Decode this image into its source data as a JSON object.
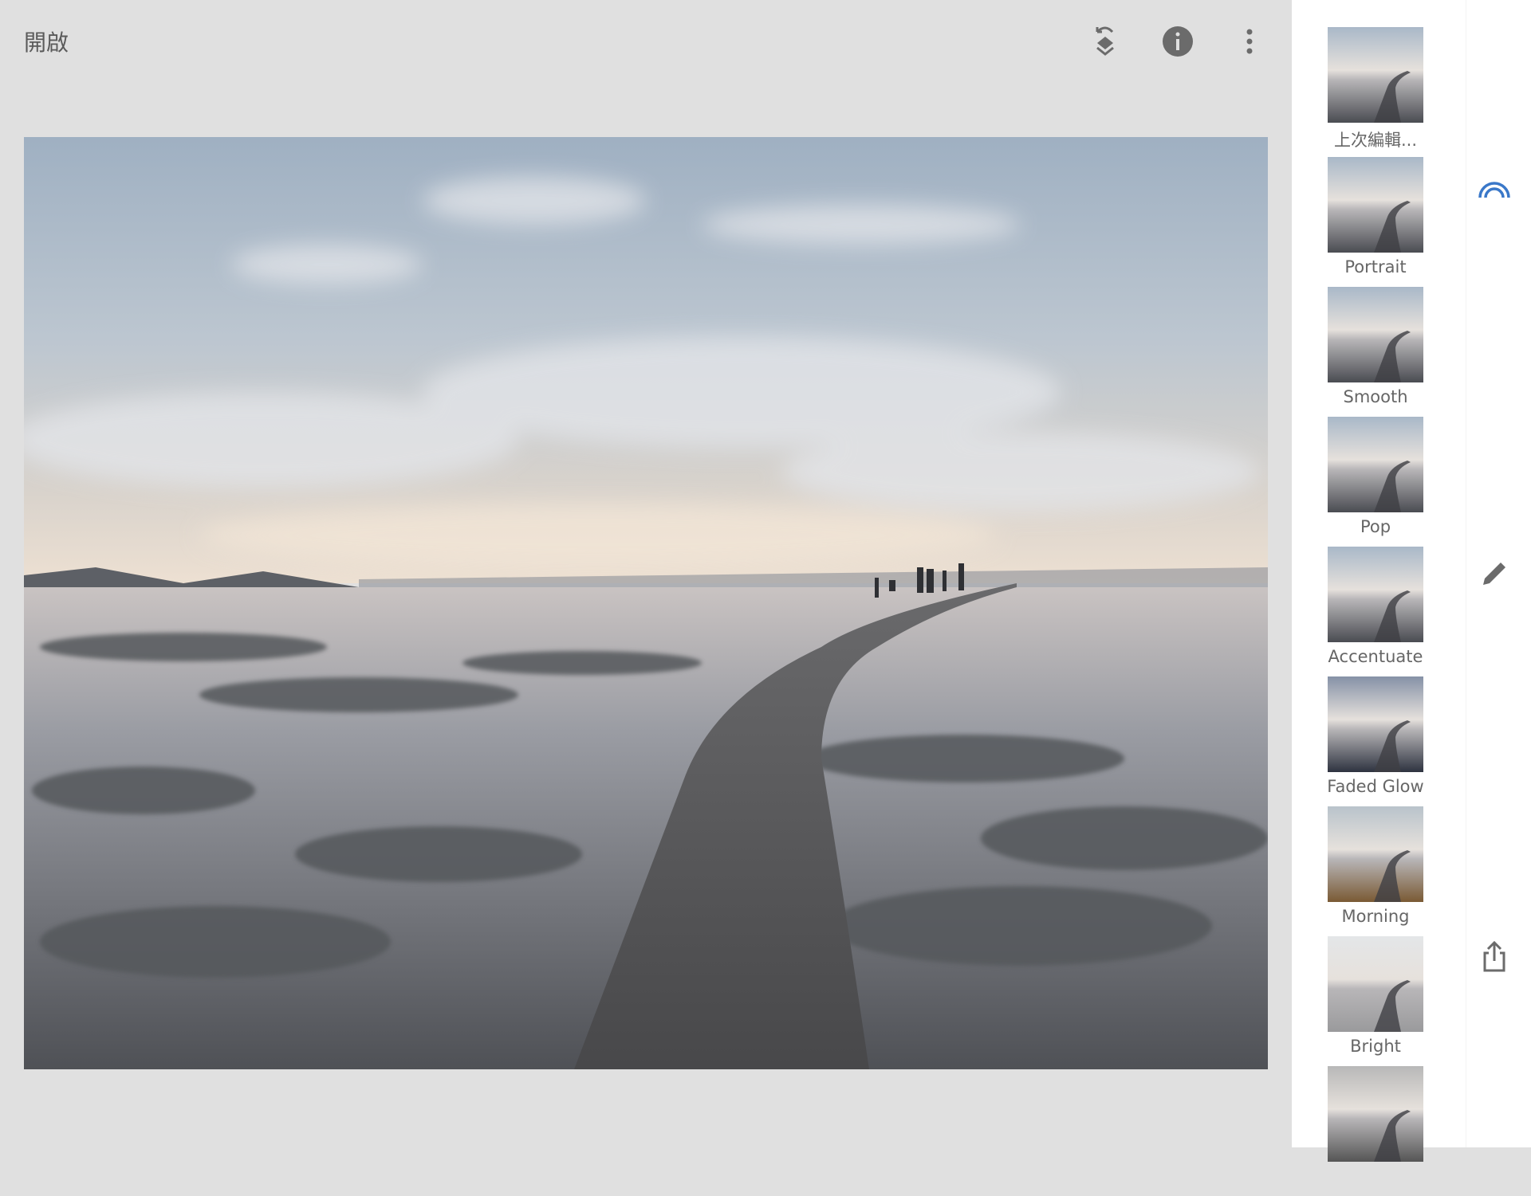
{
  "header": {
    "title": "開啟",
    "icons": [
      "undo-layers-icon",
      "info-icon",
      "more-vert-icon"
    ]
  },
  "looks": [
    {
      "label": "上次編輯...",
      "tone": "normal"
    },
    {
      "label": "Portrait",
      "tone": "normal"
    },
    {
      "label": "Smooth",
      "tone": "normal"
    },
    {
      "label": "Pop",
      "tone": "normal"
    },
    {
      "label": "Accentuate",
      "tone": "normal"
    },
    {
      "label": "Faded Glow",
      "tone": "dark"
    },
    {
      "label": "Morning",
      "tone": "warm"
    },
    {
      "label": "Bright",
      "tone": "bright"
    },
    {
      "label": "",
      "tone": "mono"
    }
  ],
  "right_rail": {
    "icons": [
      "looks-icon",
      "edit-pencil-icon",
      "share-icon"
    ],
    "accent": "#3a78c9"
  },
  "colors": {
    "icon": "#6b6b6b",
    "background": "#e0e0e0",
    "sidebar": "#ffffff"
  }
}
